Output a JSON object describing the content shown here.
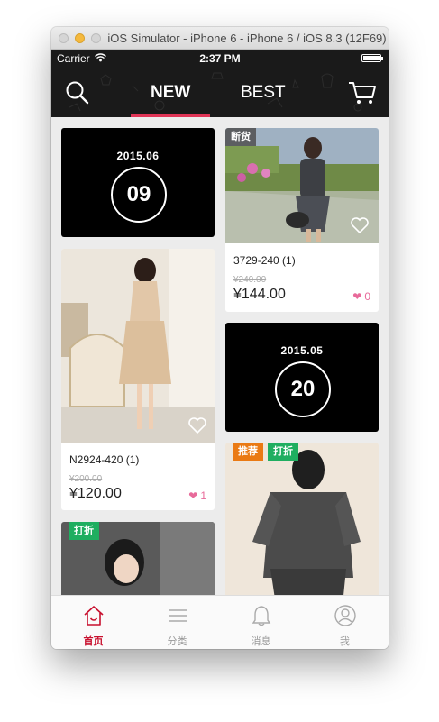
{
  "window": {
    "title": "iOS Simulator - iPhone 6 - iPhone 6 / iOS 8.3 (12F69)"
  },
  "status_bar": {
    "carrier": "Carrier",
    "time": "2:37 PM"
  },
  "nav": {
    "tabs": [
      {
        "label": "NEW",
        "active": true
      },
      {
        "label": "BEST",
        "active": false
      }
    ],
    "accent_color": "#e03456",
    "icons": [
      "search-icon",
      "cart-icon"
    ]
  },
  "feed": {
    "date_cards": [
      {
        "year_month": "2015.06",
        "day": "09"
      },
      {
        "year_month": "2015.05",
        "day": "20"
      }
    ],
    "products": [
      {
        "tag": "断货",
        "code": "3729-240 (1)",
        "old_price": "¥240.00",
        "price": "¥144.00",
        "likes": "0"
      },
      {
        "code": "N2924-420 (1)",
        "old_price": "¥200.00",
        "price": "¥120.00",
        "likes": "1"
      },
      {
        "tags": [
          "推荐",
          "打折"
        ]
      },
      {
        "tag": "打折"
      }
    ]
  },
  "tab_bar": {
    "items": [
      {
        "label": "首页",
        "icon": "home-icon",
        "active": true
      },
      {
        "label": "分类",
        "icon": "list-icon",
        "active": false
      },
      {
        "label": "消息",
        "icon": "bell-icon",
        "active": false
      },
      {
        "label": "我",
        "icon": "user-icon",
        "active": false
      }
    ],
    "active_color": "#c8102e"
  }
}
